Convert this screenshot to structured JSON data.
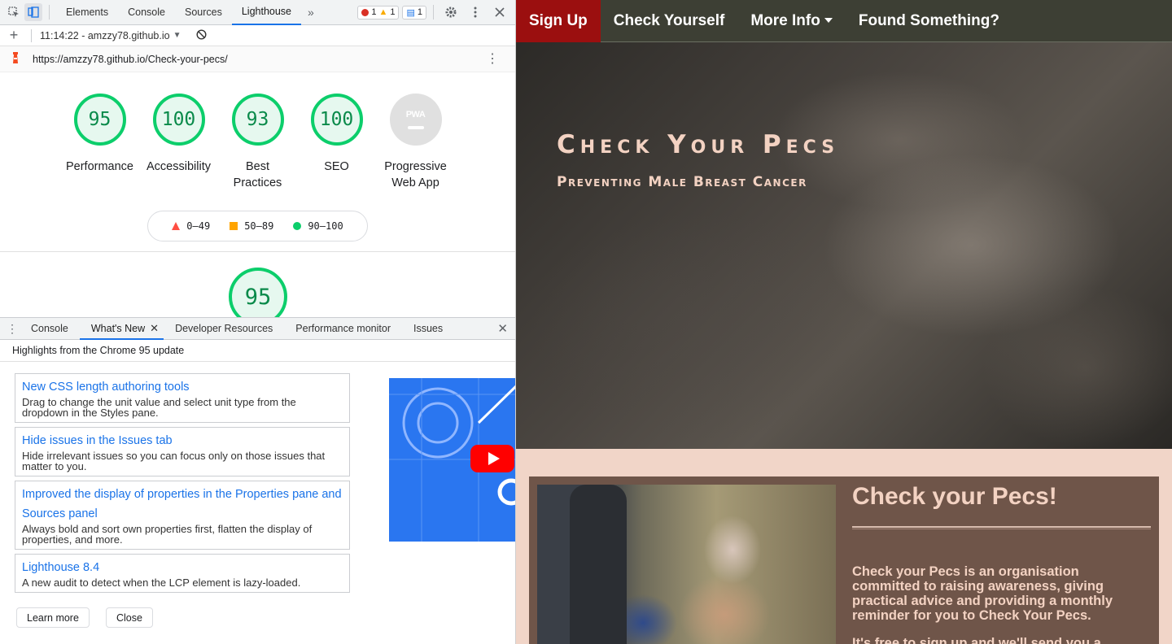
{
  "devtools": {
    "tabs": [
      "Elements",
      "Console",
      "Sources",
      "Lighthouse"
    ],
    "active_tab": "Lighthouse",
    "more_tabs": "»",
    "badges": {
      "errors": "1",
      "warnings": "1",
      "messages": "1"
    },
    "report_time": "11:14:22 - amzzy78.github.io",
    "url": "https://amzzy78.github.io/Check-your-pecs/",
    "scores": [
      {
        "value": "95",
        "label": "Performance"
      },
      {
        "value": "100",
        "label": "Accessibility"
      },
      {
        "value": "93",
        "label": "Best Practices"
      },
      {
        "value": "100",
        "label": "SEO"
      },
      {
        "value": "",
        "label": "Progressive Web App"
      }
    ],
    "pwa_badge": "PWA",
    "legend": {
      "low": "0–49",
      "mid": "50–89",
      "high": "90–100"
    },
    "perf_score": "95",
    "colors": {
      "pass": "#0cce6b",
      "average": "#ffa400",
      "fail": "#ff4e42",
      "link": "#1a73e8"
    },
    "drawer": {
      "tabs": [
        "Console",
        "What's New",
        "Developer Resources",
        "Performance monitor",
        "Issues"
      ],
      "active_tab": "What's New",
      "highlights": "Highlights from the Chrome 95 update",
      "news": [
        {
          "title": "New CSS length authoring tools",
          "desc": "Drag to change the unit value and select unit type from the dropdown in the Styles pane."
        },
        {
          "title": "Hide issues in the Issues tab",
          "desc": "Hide irrelevant issues so you can focus only on those issues that matter to you."
        },
        {
          "title": "Improved the display of properties in the Properties pane and Sources panel",
          "desc": "Always bold and sort own properties first, flatten the display of properties, and more."
        },
        {
          "title": "Lighthouse 8.4",
          "desc": "A new audit to detect when the LCP element is lazy-loaded."
        }
      ],
      "learn_more": "Learn more",
      "close": "Close"
    }
  },
  "site": {
    "nav": {
      "signup": "Sign Up",
      "check": "Check Yourself",
      "more": "More Info",
      "found": "Found Something?"
    },
    "hero_title": "Check Your Pecs",
    "hero_subtitle": "Preventing Male Breast Cancer",
    "card_title": "Check your Pecs!",
    "card_text": "Check your Pecs is an organisation committed to raising awareness, giving practical advice and providing a monthly reminder for you to Check Your Pecs.",
    "card_text2": "It's free to sign up and we'll send you a",
    "colors": {
      "nav_bg": "#3d3f34",
      "signup_bg": "#9b0f0f",
      "card_bg": "#6f5549",
      "page_bg": "#f1d5c8",
      "accent_text": "#f3d2c2"
    }
  }
}
